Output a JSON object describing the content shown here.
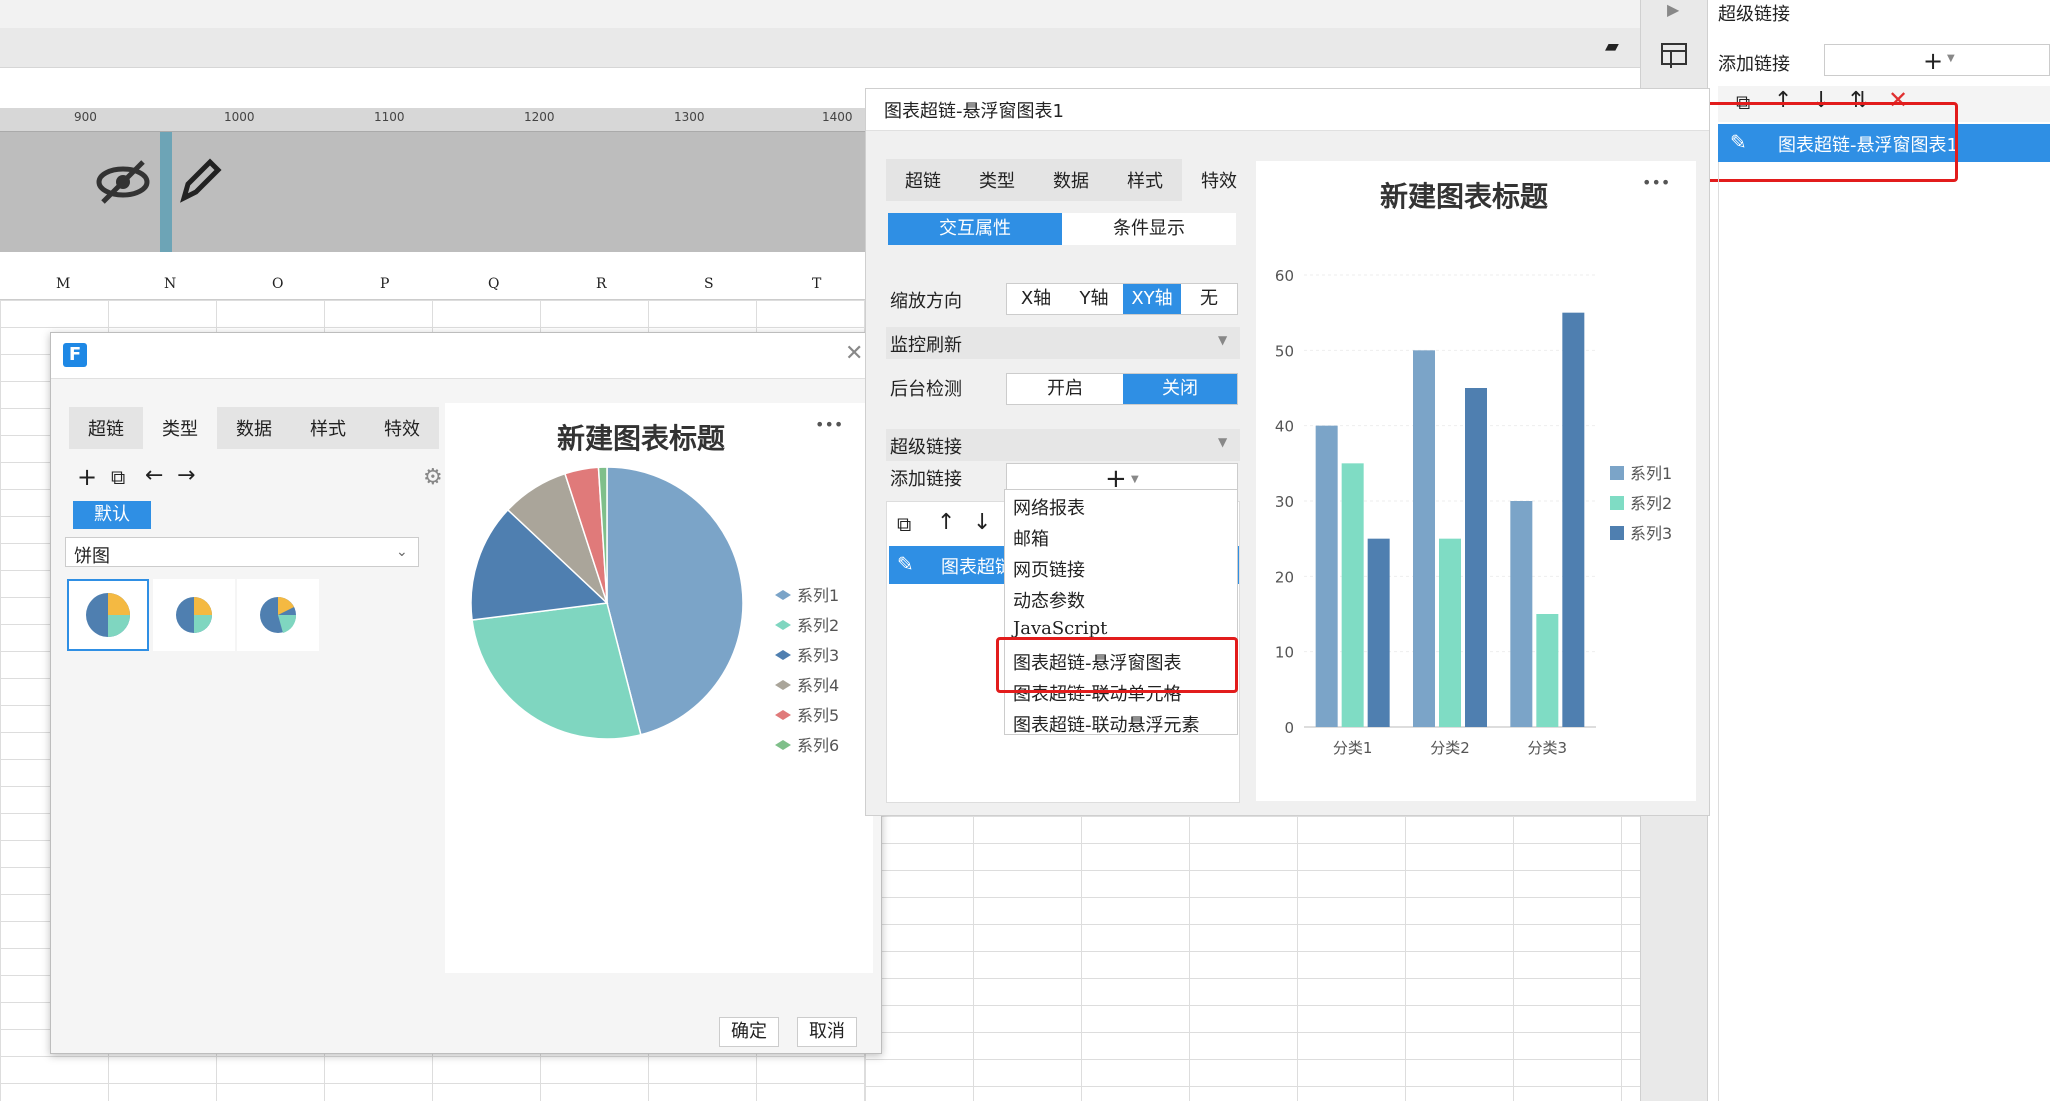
{
  "ruler": {
    "ticks": [
      "900",
      "1000",
      "1100",
      "1200",
      "1300",
      "1400"
    ]
  },
  "columns": [
    "M",
    "N",
    "O",
    "P",
    "Q",
    "R",
    "S",
    "T"
  ],
  "right_panel": {
    "title": "超级链接",
    "add_label": "添加链接",
    "add_button": "+",
    "selected_item": "图表超链-悬浮窗图表1"
  },
  "dialog": {
    "tabs": [
      "超链",
      "类型",
      "数据",
      "样式",
      "特效"
    ],
    "default_badge": "默认",
    "chart_type_select": "饼图",
    "ok": "确定",
    "cancel": "取消",
    "preview_title": "新建图表标题",
    "more": "•••"
  },
  "panel2": {
    "header": "图表超链-悬浮窗图表1",
    "tabs": [
      "超链",
      "类型",
      "数据",
      "样式",
      "特效"
    ],
    "subtabs": [
      "交互属性",
      "条件显示"
    ],
    "zoom_label": "缩放方向",
    "zoom_options": [
      "X轴",
      "Y轴",
      "XY轴",
      "无"
    ],
    "monitor_label": "监控刷新",
    "backend_label": "后台检测",
    "backend_options": [
      "开启",
      "关闭"
    ],
    "hyperlink_label": "超级链接",
    "add_link_label": "添加链接",
    "add_button": "+",
    "list_item_partial": "图表超链",
    "menu": [
      "网络报表",
      "邮箱",
      "网页链接",
      "动态参数",
      "JavaScript",
      "图表超链-悬浮窗图表",
      "图表超链-联动单元格",
      "图表超链-联动悬浮元素"
    ],
    "preview_title": "新建图表标题",
    "more": "•••"
  },
  "chart_data": [
    {
      "type": "pie",
      "title": "新建图表标题",
      "legend_position": "right",
      "series": [
        {
          "name": "系列1",
          "value": 46,
          "color": "#7ba4c8"
        },
        {
          "name": "系列2",
          "value": 27,
          "color": "#7fd6c0"
        },
        {
          "name": "系列3",
          "value": 14,
          "color": "#4f7fb0"
        },
        {
          "name": "系列4",
          "value": 8,
          "color": "#aaa59a"
        },
        {
          "name": "系列5",
          "value": 4,
          "color": "#e07a7a"
        },
        {
          "name": "系列6",
          "value": 1,
          "color": "#7fbf8a"
        }
      ]
    },
    {
      "type": "bar",
      "title": "新建图表标题",
      "categories": [
        "分类1",
        "分类2",
        "分类3"
      ],
      "ylim": [
        0,
        60
      ],
      "yticks": [
        0,
        10,
        20,
        30,
        40,
        50,
        60
      ],
      "legend_position": "right",
      "series": [
        {
          "name": "系列1",
          "values": [
            40,
            50,
            30
          ],
          "color": "#7ba4c8"
        },
        {
          "name": "系列2",
          "values": [
            35,
            25,
            15
          ],
          "color": "#7fdcc4"
        },
        {
          "name": "系列3",
          "values": [
            25,
            45,
            55
          ],
          "color": "#4f7fb0"
        }
      ]
    }
  ]
}
